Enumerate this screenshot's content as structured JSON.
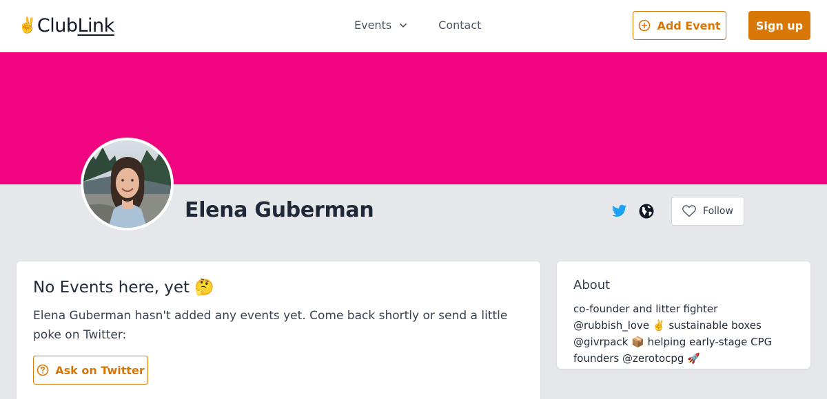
{
  "header": {
    "logo_emoji": "✌️",
    "logo_prefix": "Club",
    "logo_suffix": "Link",
    "nav": {
      "events": "Events",
      "contact": "Contact"
    },
    "add_event": "Add Event",
    "sign_up": "Sign up"
  },
  "profile": {
    "name": "Elena Guberman",
    "follow": "Follow"
  },
  "events_card": {
    "title": "No Events here, yet 🤔",
    "text": "Elena Guberman hasn't added any events yet. Come back shortly or send a little poke on Twitter:",
    "ask_button": "Ask on Twitter"
  },
  "about_card": {
    "title": "About",
    "text": "co-founder and litter fighter @rubbish_love ✌️ sustainable boxes @givrpack 📦 helping early-stage CPG founders @zerotocpg 🚀"
  },
  "colors": {
    "accent": "#d97706",
    "banner": "#f0047f",
    "twitter": "#1da1f2",
    "background": "#e5e7eb"
  },
  "icons": {
    "add": "plus-circle-icon",
    "chevron": "chevron-down-icon",
    "twitter": "twitter-icon",
    "website": "globe-icon",
    "follow": "heart-icon",
    "ask": "question-circle-icon"
  }
}
